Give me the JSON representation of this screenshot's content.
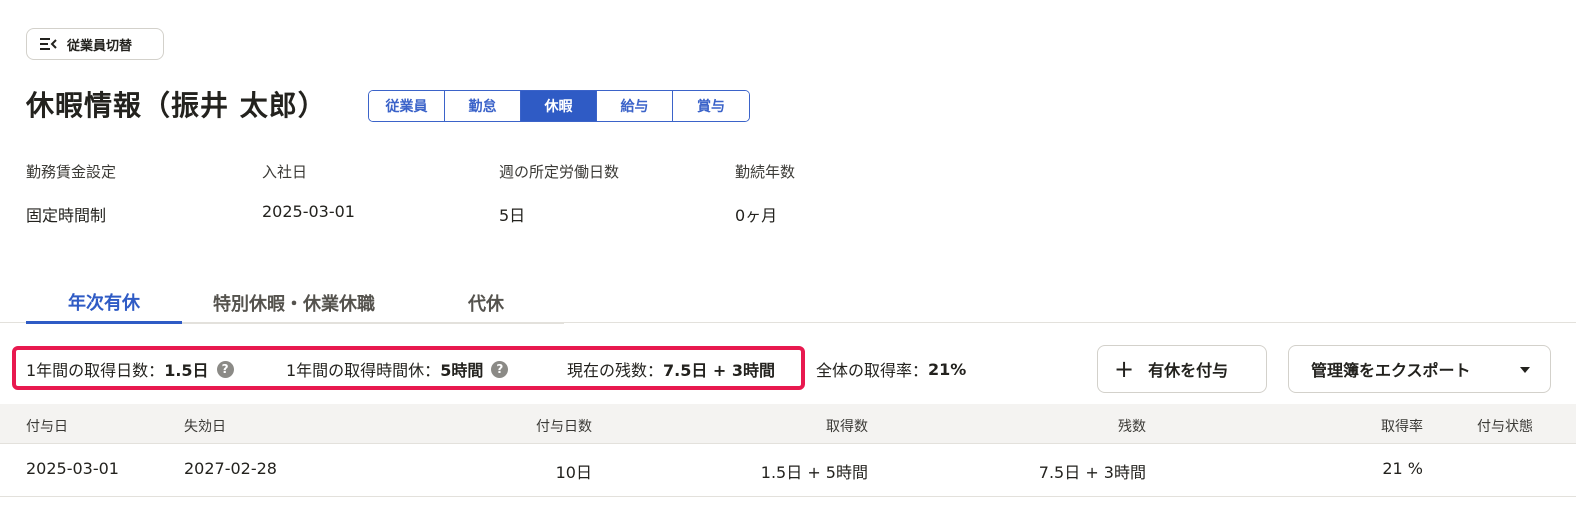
{
  "switch_button": {
    "label": "従業員切替"
  },
  "page_title": "休暇情報（振井 太郎）",
  "segments": [
    "従業員",
    "勤怠",
    "休暇",
    "給与",
    "賞与"
  ],
  "active_segment": "休暇",
  "info": {
    "labels": [
      "勤務賃金設定",
      "入社日",
      "週の所定労働日数",
      "勤続年数"
    ],
    "values": [
      "固定時間制",
      "2025-03-01",
      "5日",
      "0ヶ月"
    ]
  },
  "tabs": [
    "年次有休",
    "特別休暇・休業休職",
    "代休"
  ],
  "active_tab": "年次有休",
  "summary": {
    "days_label": "1年間の取得日数：",
    "days_value": "1.5日",
    "hours_label": "1年間の取得時間休：",
    "hours_value": "5時間",
    "remain_label": "現在の残数：",
    "remain_value": "7.5日 + 3時間",
    "rate_label": "全体の取得率：",
    "rate_value": "21%",
    "help_glyph": "?"
  },
  "buttons": {
    "add_plus": "+",
    "add_label": "有休を付与",
    "export_label": "管理簿をエクスポート"
  },
  "table": {
    "headers": [
      "付与日",
      "失効日",
      "付与日数",
      "取得数",
      "残数",
      "取得率",
      "付与状態"
    ],
    "rows": [
      [
        "2025-03-01",
        "2027-02-28",
        "10日",
        "1.5日 + 5時間",
        "7.5日 + 3時間",
        "21 %",
        ""
      ]
    ]
  },
  "colors": {
    "accent": "#2f5bc5",
    "highlight": "#e8194f"
  }
}
